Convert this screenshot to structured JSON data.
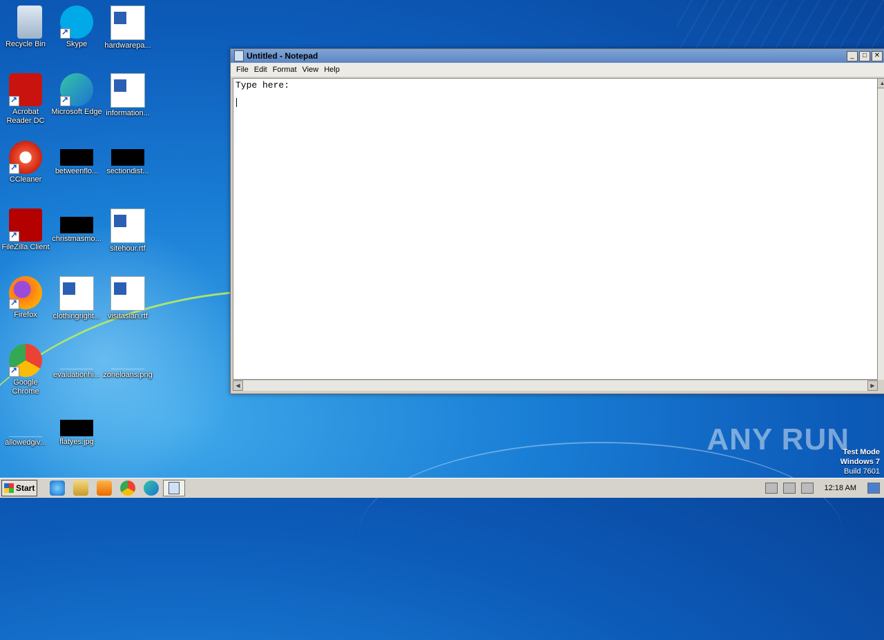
{
  "desktop": {
    "icons": [
      {
        "label": "Recycle Bin",
        "icon": "recycle-bin-icon"
      },
      {
        "label": "Skype",
        "icon": "skype-icon"
      },
      {
        "label": "hardwarepa...",
        "icon": "word-doc-icon"
      },
      {
        "label": "Acrobat Reader DC",
        "icon": "acrobat-icon"
      },
      {
        "label": "Microsoft Edge",
        "icon": "edge-icon"
      },
      {
        "label": "information...",
        "icon": "word-doc-icon"
      },
      {
        "label": "CCleaner",
        "icon": "ccleaner-icon"
      },
      {
        "label": "betweenflo...",
        "icon": "black-thumbnail-icon"
      },
      {
        "label": "sectiondist...",
        "icon": "black-thumbnail-icon"
      },
      {
        "label": "FileZilla Client",
        "icon": "filezilla-icon"
      },
      {
        "label": "christmasmo...",
        "icon": "black-thumbnail-icon"
      },
      {
        "label": "sitehour.rtf",
        "icon": "word-doc-icon"
      },
      {
        "label": "Firefox",
        "icon": "firefox-icon"
      },
      {
        "label": "clothingright...",
        "icon": "word-doc-icon"
      },
      {
        "label": "visitasian.rtf",
        "icon": "word-doc-icon"
      },
      {
        "label": "Google Chrome",
        "icon": "chrome-icon"
      },
      {
        "label": "evaluationhi...",
        "icon": "blank-thumbnail-icon"
      },
      {
        "label": "zoneloans.png",
        "icon": "blank-thumbnail-icon"
      },
      {
        "label": "allowedgiv...",
        "icon": "blank-thumbnail-icon"
      },
      {
        "label": "flatyes.jpg",
        "icon": "black-thumbnail-icon"
      }
    ]
  },
  "notepad": {
    "title": "Untitled - Notepad",
    "menu": [
      "File",
      "Edit",
      "Format",
      "View",
      "Help"
    ],
    "content": "Type here:"
  },
  "taskbar": {
    "start_label": "Start",
    "clock": "12:18 AM",
    "pinned": [
      "ie-icon",
      "explorer-icon",
      "media-player-icon",
      "chrome-icon",
      "edge-icon"
    ],
    "active": "notepad-icon"
  },
  "watermark": {
    "brand": "ANY RUN",
    "line1": "Test Mode",
    "line2": "Windows 7",
    "line3": "Build 7601"
  },
  "colors": {
    "title_bar": "#5e86c4",
    "desktop": "#0d5cba"
  }
}
